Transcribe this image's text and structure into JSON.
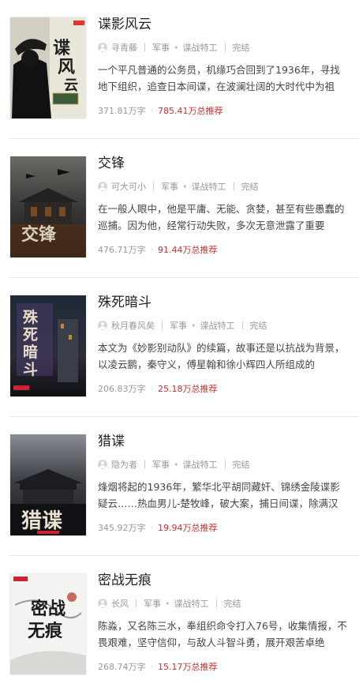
{
  "books": [
    {
      "title": "谍影风云",
      "author": "寻青藤",
      "category": "军事",
      "subcategory": "谍战特工",
      "status": "完结",
      "desc": "一个平凡普通的公务员，机缘巧合回到了1936年，寻找地下组织，追查日本间谍，在波澜壮阔的大时代中为祖",
      "words": "371.81万字",
      "recommend": "785.41万总推荐",
      "cover_text": "谍影风云"
    },
    {
      "title": "交锋",
      "author": "可大可小",
      "category": "军事",
      "subcategory": "谍战特工",
      "status": "完结",
      "desc": "在一般人眼中，他是平庸、无能、贪婪，甚至有些愚蠢的巡捕。因为他，经常行动失败，多次无意泄露了重要",
      "words": "476.71万字",
      "recommend": "91.44万总推荐",
      "cover_text": "交锋"
    },
    {
      "title": "殊死暗斗",
      "author": "秋月春风矣",
      "category": "军事",
      "subcategory": "谍战特工",
      "status": "完结",
      "desc": "本文为《妙影别动队》的续篇，故事还是以抗战为背景，以凌云鹏，秦守义，傅星翰和徐小辉四人所组成的",
      "words": "206.83万字",
      "recommend": "25.18万总推荐",
      "cover_text": "殊死暗斗"
    },
    {
      "title": "猎谍",
      "author": "隐为者",
      "category": "军事",
      "subcategory": "谍战特工",
      "status": "完结",
      "desc": "烽烟将起的1936年，繁华北平胡同藏奸、锦绣金陵谍影疑云……热血男儿-楚牧峰，破大案，捕日间谍，除满汉",
      "words": "345.92万字",
      "recommend": "19.94万总推荐",
      "cover_text": "猎谍"
    },
    {
      "title": "密战无痕",
      "author": "长风",
      "category": "军事",
      "subcategory": "谍战特工",
      "status": "完结",
      "desc": "陈淼，又名陈三水，奉组织命令打入76号，收集情报，不畏艰难，坚守信仰，与敌人斗智斗勇，展开艰苦卓绝",
      "words": "268.74万字",
      "recommend": "15.17万总推荐",
      "cover_text": "密战无痕"
    }
  ]
}
